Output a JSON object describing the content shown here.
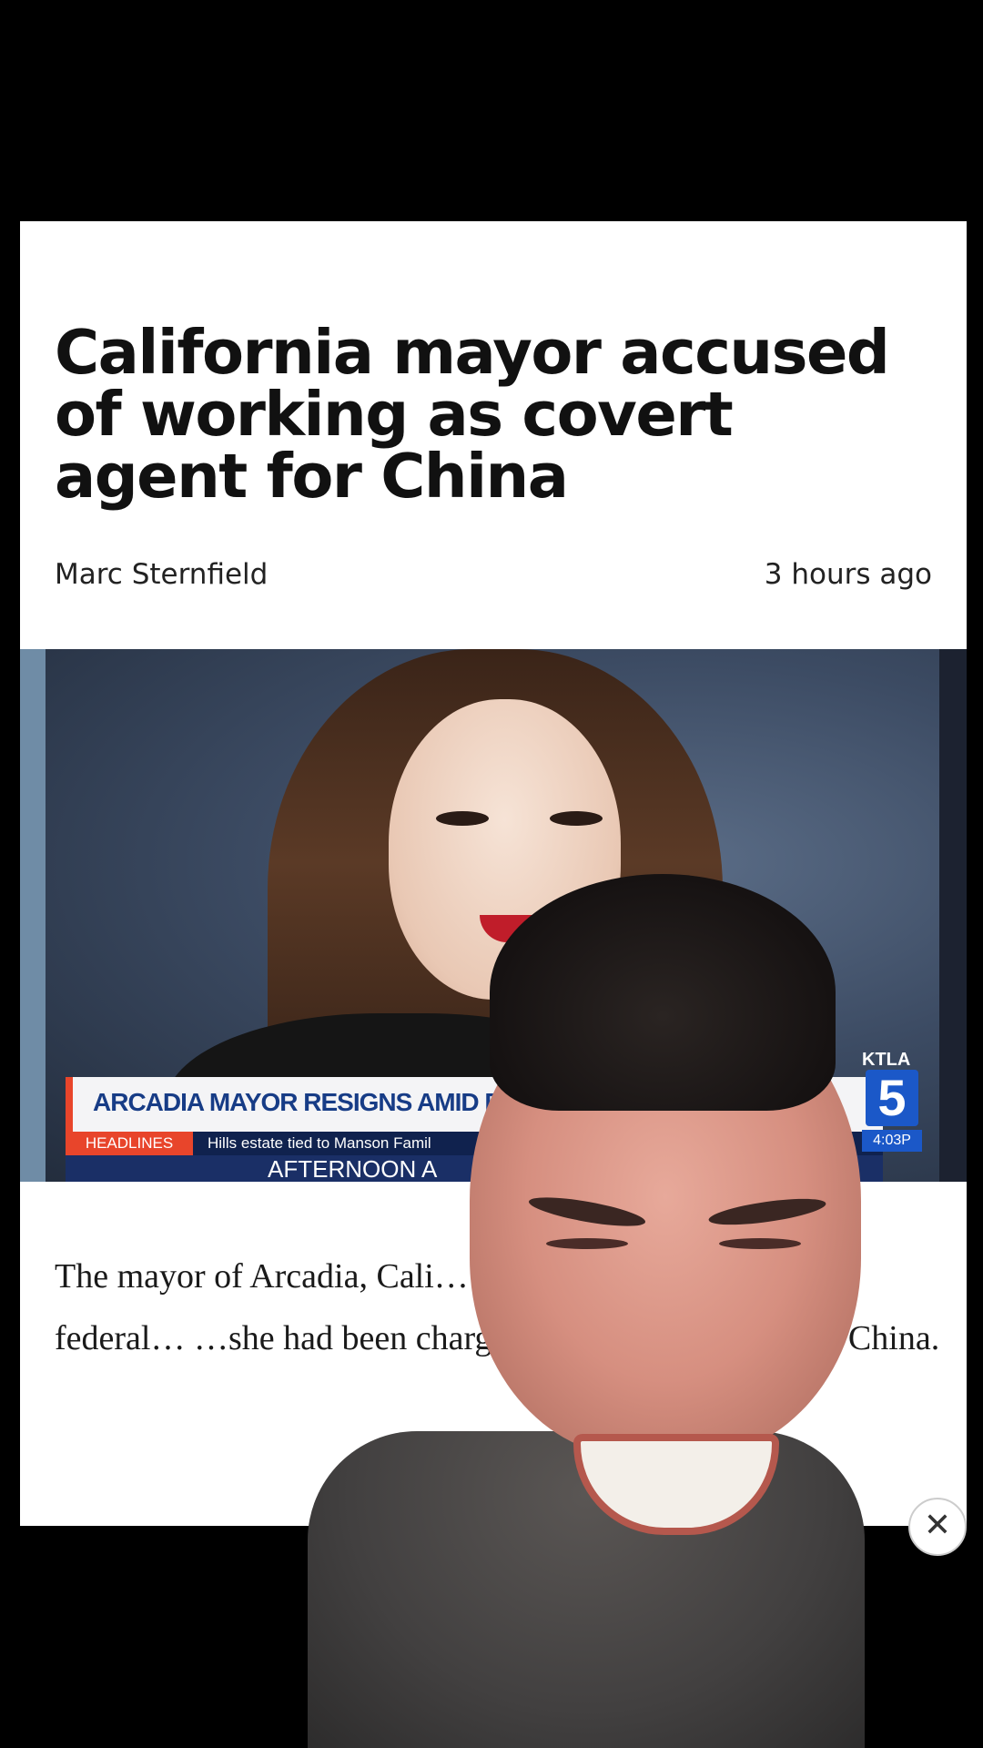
{
  "article": {
    "headline": "California mayor accused of working as covert agent for China",
    "author": "Marc Sternfield",
    "time_ago": "3 hours ago",
    "body": "The mayor of Arcadia, Cali… …ptly resigned Monday as federal… …she had been charged with actin… …ent for China."
  },
  "broadcast": {
    "title": "ARCADIA MAYOR RESIGNS AMID FED",
    "tag": "HEADLINES",
    "subtitle": "Hills estate tied to Manson Famil",
    "show": "AFTERNOON A",
    "station": "KTLA",
    "channel": "5",
    "clock": "4:03P"
  },
  "controls": {
    "close_glyph": "✕"
  },
  "colors": {
    "lower_third_title": "#173c86",
    "lower_third_tag": "#e8452b",
    "station_blue": "#1b58c8"
  }
}
